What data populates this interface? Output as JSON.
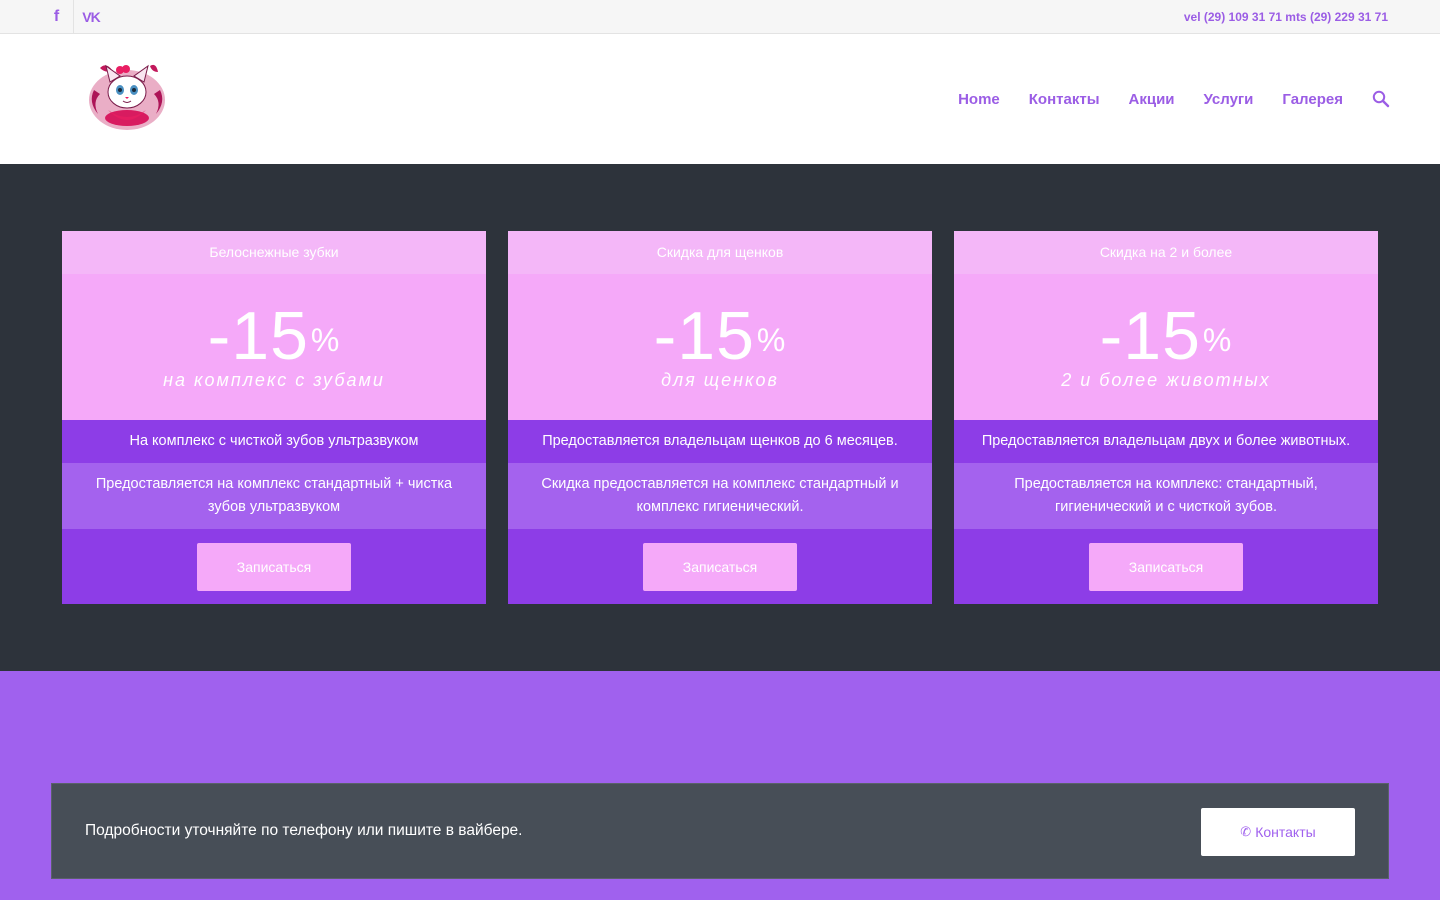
{
  "topbar": {
    "social": [
      {
        "name": "facebook-icon",
        "glyph": "f"
      },
      {
        "name": "vk-icon",
        "glyph": "VK"
      }
    ],
    "phones": "vel (29) 109 31 71 mts (29) 229 31 71"
  },
  "header": {
    "logo_icon": "cat-logo-icon",
    "nav": [
      "Home",
      "Контакты",
      "Акции",
      "Услуги",
      "Галерея"
    ],
    "search_icon": "search-icon"
  },
  "cards": [
    {
      "title": "Белоснежные зубки",
      "price": "-15",
      "percent": "%",
      "price_subtitle": "на комплекс с зубами",
      "row1": "На комплекс с чисткой зубов ультразвуком",
      "row2": "Предоставляется на комплекс стандартный + чистка зубов ультразвуком",
      "button": "Записаться"
    },
    {
      "title": "Скидка для щенков",
      "price": "-15",
      "percent": "%",
      "price_subtitle": "для щенков",
      "row1": "Предоставляется владельцам щенков до 6 месяцев.",
      "row2": "Скидка предоставляется на комплекс стандартный и комплекс гигиенический.",
      "button": "Записаться"
    },
    {
      "title": "Скидка на 2 и более",
      "price": "-15",
      "percent": "%",
      "price_subtitle": "2 и более животных",
      "row1": "Предоставляется владельцам двух и более животных.",
      "row2": "Предоставляется на комплекс: стандартный, гигиенический и с чисткой зубов.",
      "button": "Записаться"
    }
  ],
  "cta": {
    "text": "Подробности уточняйте по телефону или пишите в вайбере.",
    "button_icon": "phone-icon",
    "button_glyph": "✆",
    "button": "Контакты"
  },
  "colors": {
    "accent": "#9b5de5",
    "card_light": "#f5a9f9",
    "card_dark": "#8d3de7",
    "dark_bg": "#2d333b",
    "purple_bg": "#a061ee"
  }
}
